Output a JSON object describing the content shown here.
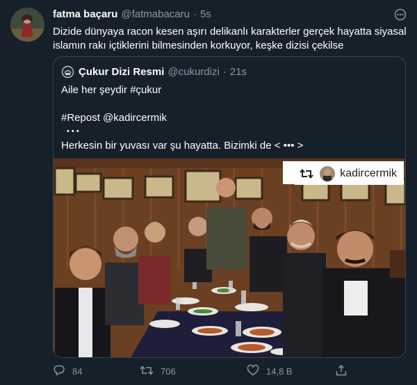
{
  "tweet": {
    "author_name": "fatma baçaru",
    "author_handle": "@fatmabacaru",
    "separator": "·",
    "time": "5s",
    "text": "Dizide dünyaya racon kesen aşırı delikanlı karakterler gerçek hayatta siyasal islamın rakı içtiklerini bilmesinden korkuyor, keşke dizisi çekilse"
  },
  "quote": {
    "author_name": "Çukur Dizi Resmi",
    "author_handle": "@cukurdizi",
    "separator": "·",
    "time": "21s",
    "lines": [
      "Aile her şeydir #çukur",
      "",
      "#Repost @kadircermik",
      "• • •",
      "Herkesin bir yuvası var şu hayatta. Bizimki de < ••• >"
    ],
    "photo_badge": "kadircermik"
  },
  "actions": {
    "replies": "84",
    "retweets": "706",
    "likes": "14,8 B"
  },
  "icons": {
    "more": "more-icon",
    "reply": "reply-icon",
    "retweet": "retweet-icon",
    "like": "heart-icon",
    "share": "share-icon"
  },
  "colors": {
    "background": "#15202b",
    "secondary_text": "#8899a6",
    "border": "#38444d"
  }
}
